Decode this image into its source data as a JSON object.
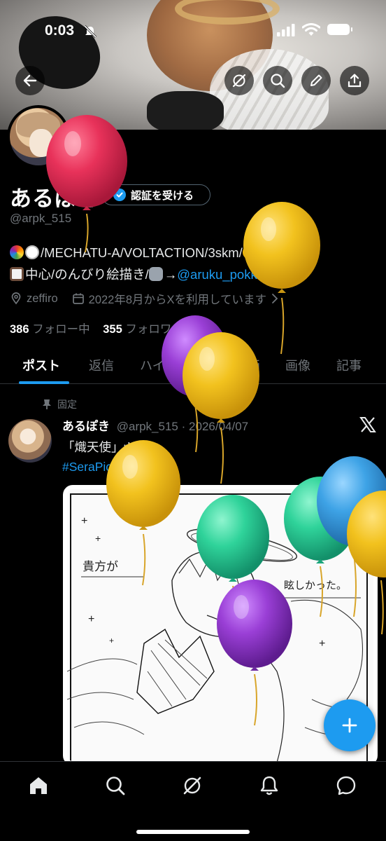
{
  "status_bar": {
    "time": "0:03"
  },
  "banner": {
    "buttons": [
      "back-arrow-icon",
      "grok-icon",
      "search-icon",
      "edit-icon",
      "share-icon"
    ]
  },
  "profile": {
    "display_name": "あるぽき",
    "verify_button_label": "認証を受ける",
    "handle": "@arpk_515",
    "bio": {
      "line1_text": "/MECHATU-A/VOLTACTION/3skm/",
      "line2_text": "中心/のんびり絵描き/",
      "line2_arrow": "→",
      "link": "@aruku_pokki",
      "line2_end": "/"
    },
    "location": "zeffiro",
    "joined": "2022年8月からXを利用しています",
    "following_count": "386",
    "following_label": "フォロー中",
    "followers_count": "355",
    "followers_label": "フォロワー"
  },
  "tabs": [
    {
      "label": "ポスト",
      "active": true
    },
    {
      "label": "返信",
      "active": false
    },
    {
      "label": "ハイライト",
      "active": false
    },
    {
      "label": "動画",
      "active": false
    },
    {
      "label": "画像",
      "active": false
    },
    {
      "label": "記事",
      "active": false
    }
  ],
  "post": {
    "pinned_label": "固定",
    "author_name": "あるぽき",
    "author_handle": "@arpk_515",
    "separator": "·",
    "date": "2026/04/07",
    "text": "「熾天使」rkgk",
    "hashtag": "#SeraPic",
    "image_text": [
      "貴方が",
      "眩しかった。"
    ]
  },
  "colors": {
    "accent": "#1d9bf0",
    "muted": "#71767b",
    "balloon_red": "#e8325a",
    "balloon_yellow": "#f2c21e",
    "balloon_purple": "#9a3fd6",
    "balloon_green": "#2fd39a",
    "balloon_blue": "#3ea3e6"
  },
  "bottom_nav": [
    "home-icon",
    "search-icon",
    "grok-icon",
    "notifications-icon",
    "messages-icon"
  ]
}
